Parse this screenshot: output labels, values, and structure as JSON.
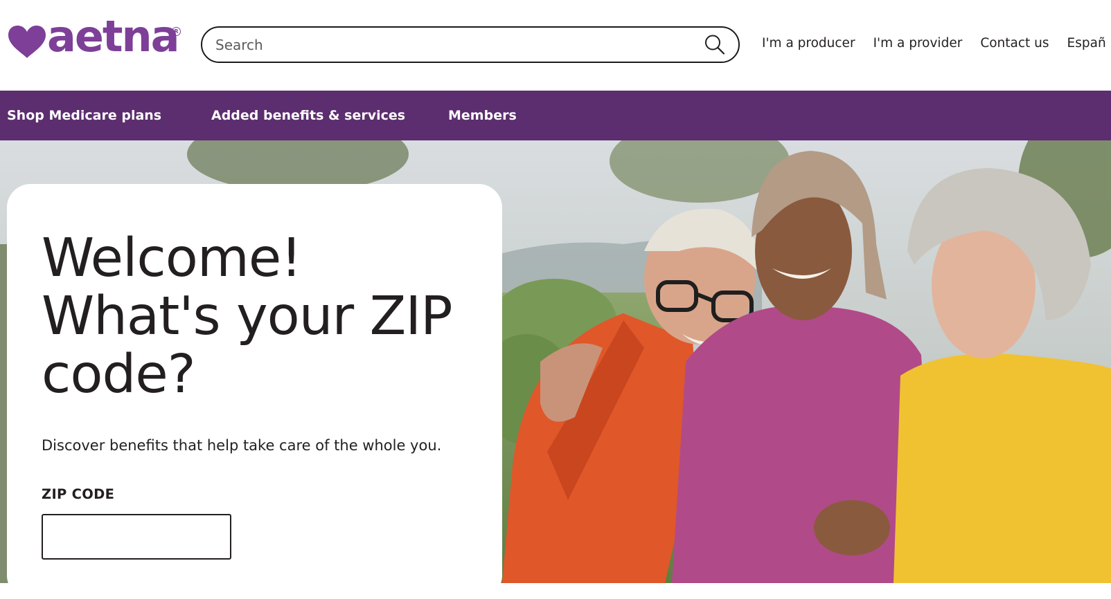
{
  "brand": {
    "name": "aetna",
    "color": "#7d3f98"
  },
  "header": {
    "search": {
      "placeholder": "Search",
      "value": "",
      "icon": "search-icon"
    },
    "links": [
      {
        "label": "I'm a producer"
      },
      {
        "label": "I'm a provider"
      },
      {
        "label": "Contact us"
      },
      {
        "label": "Españ"
      }
    ]
  },
  "nav": {
    "background": "#5c2d6f",
    "items": [
      {
        "label": "Shop Medicare plans"
      },
      {
        "label": "Added benefits & services"
      },
      {
        "label": "Members"
      }
    ]
  },
  "hero": {
    "headline": [
      "Welcome!",
      "What's your ZIP",
      "code?"
    ],
    "subtext": "Discover benefits that help take care of the whole you.",
    "zip": {
      "label": "ZIP CODE",
      "value": ""
    }
  }
}
